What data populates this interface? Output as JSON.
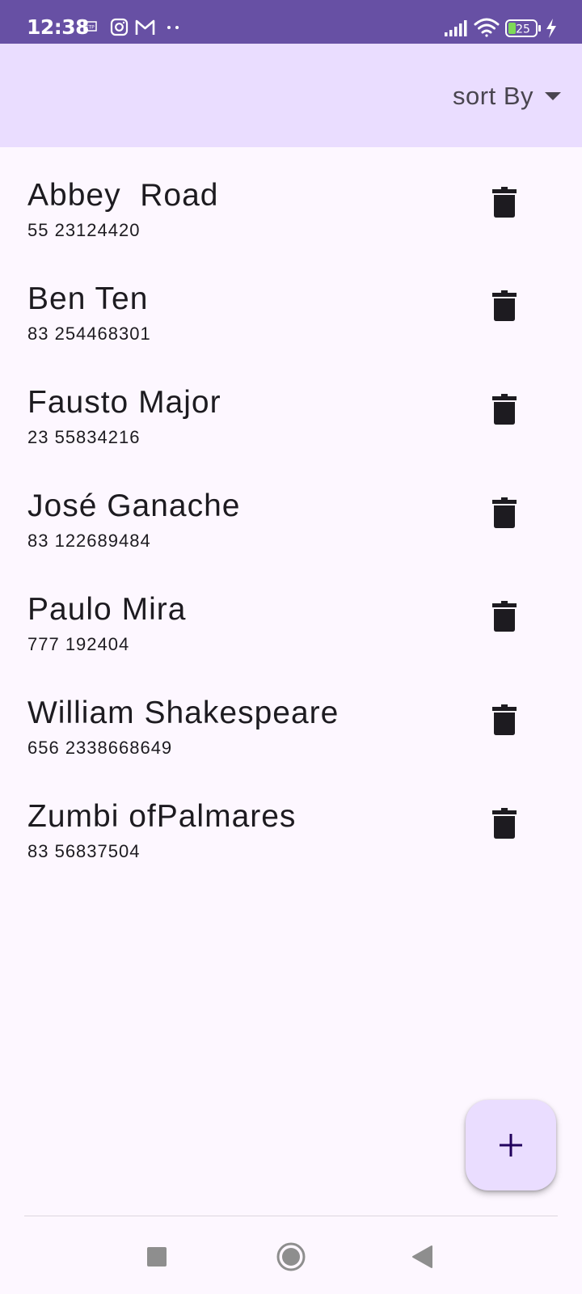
{
  "status_bar": {
    "time": "12:38",
    "battery": "25",
    "icons": [
      "ftp-icon",
      "instagram-icon",
      "gmail-icon",
      "more-dots-icon",
      "signal-icon",
      "wifi-icon",
      "battery-icon",
      "charging-icon"
    ]
  },
  "app_bar": {
    "sort_label": "sort By"
  },
  "contacts": [
    {
      "name": "Abbey  Road",
      "phone": "55 23124420"
    },
    {
      "name": "Ben Ten",
      "phone": "83 254468301"
    },
    {
      "name": "Fausto Major",
      "phone": "23 55834216"
    },
    {
      "name": "José Ganache",
      "phone": "83 122689484"
    },
    {
      "name": "Paulo Mira",
      "phone": "777 192404"
    },
    {
      "name": "William Shakespeare",
      "phone": "656 2338668649"
    },
    {
      "name": "Zumbi ofPalmares",
      "phone": "83 56837504"
    }
  ],
  "colors": {
    "status_bar": "#6750a4",
    "app_bar": "#eaddff",
    "background": "#fdf7ff",
    "fab": "#eaddff",
    "fab_icon": "#21005d"
  }
}
